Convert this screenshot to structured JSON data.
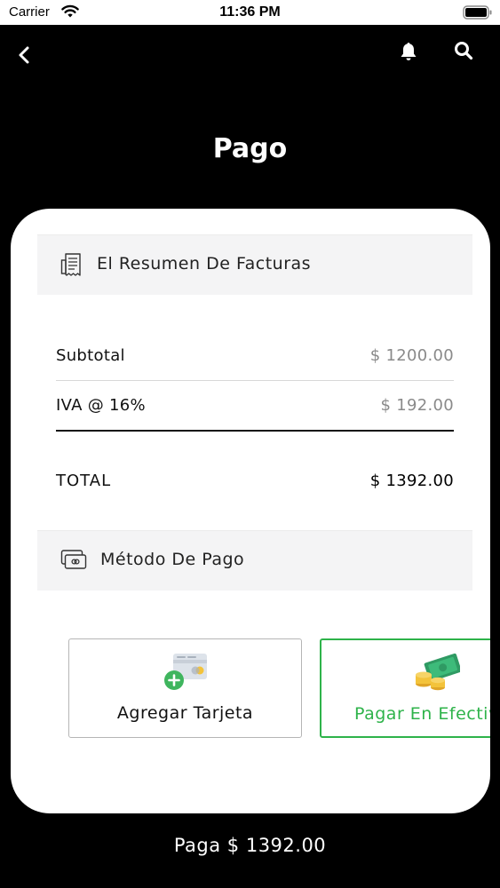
{
  "status_bar": {
    "carrier": "Carrier",
    "time": "11:36 PM"
  },
  "header": {
    "title": "Pago"
  },
  "bill_summary": {
    "heading": "El Resumen De Facturas",
    "subtotal_label": "Subtotal",
    "subtotal_value": "$ 1200.00",
    "vat_label": "IVA @ 16%",
    "vat_value": "$ 192.00",
    "total_label": "TOTAL",
    "total_value": "$ 1392.00"
  },
  "payment_method": {
    "heading": "Método De Pago",
    "options": [
      {
        "label": "Agregar Tarjeta",
        "icon": "add-card-icon"
      },
      {
        "label": "Pagar En Efectivo",
        "icon": "cash-icon",
        "selected": true
      }
    ]
  },
  "footer": {
    "pay_label": "Paga $ 1392.00"
  },
  "colors": {
    "accent": "#2eb34a",
    "background": "#000000",
    "card": "#ffffff",
    "section_header": "#f4f4f5"
  }
}
